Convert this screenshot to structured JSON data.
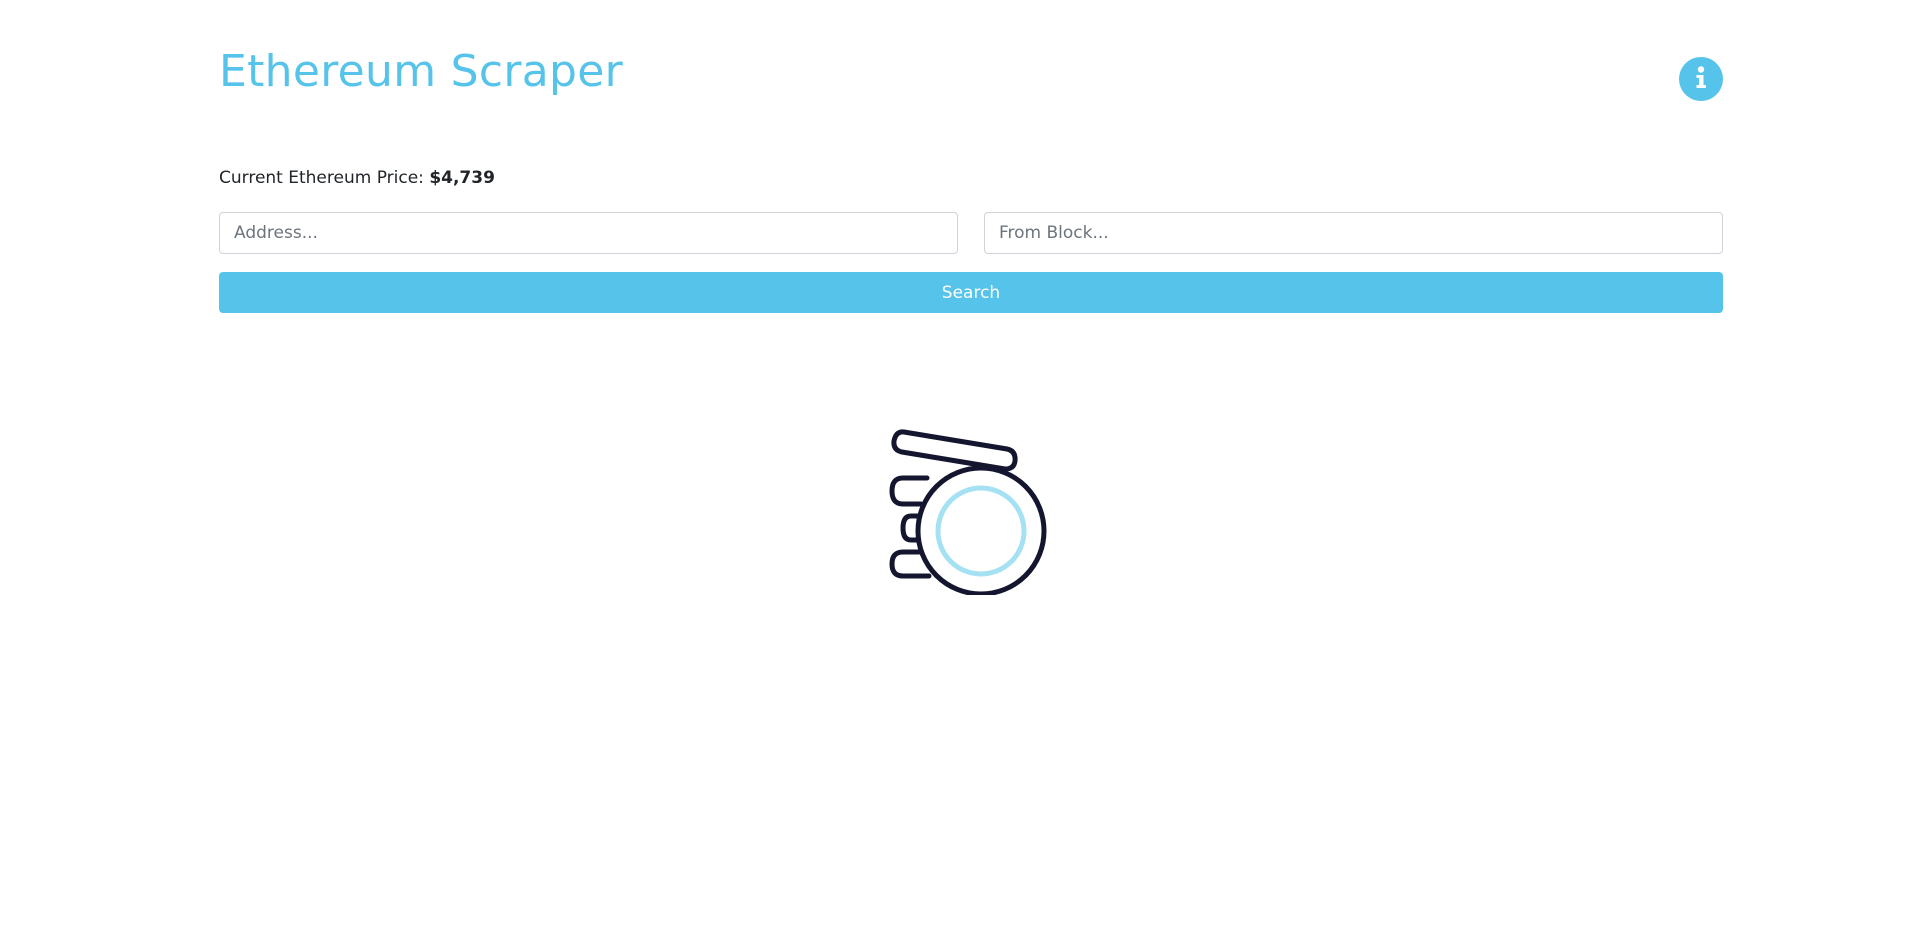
{
  "header": {
    "title": "Ethereum Scraper",
    "info_icon": "info-icon"
  },
  "price": {
    "label": "Current Ethereum Price: ",
    "value": "$4,739"
  },
  "search": {
    "address_placeholder": "Address...",
    "address_value": "",
    "block_placeholder": "From Block...",
    "block_value": "",
    "button_label": "Search"
  },
  "loader": {
    "icon": "hand-holding-coin-icon"
  },
  "colors": {
    "accent": "#55c3ea",
    "text": "#212529",
    "loader_stroke": "#14152f",
    "loader_inner": "#a4e1f3"
  }
}
